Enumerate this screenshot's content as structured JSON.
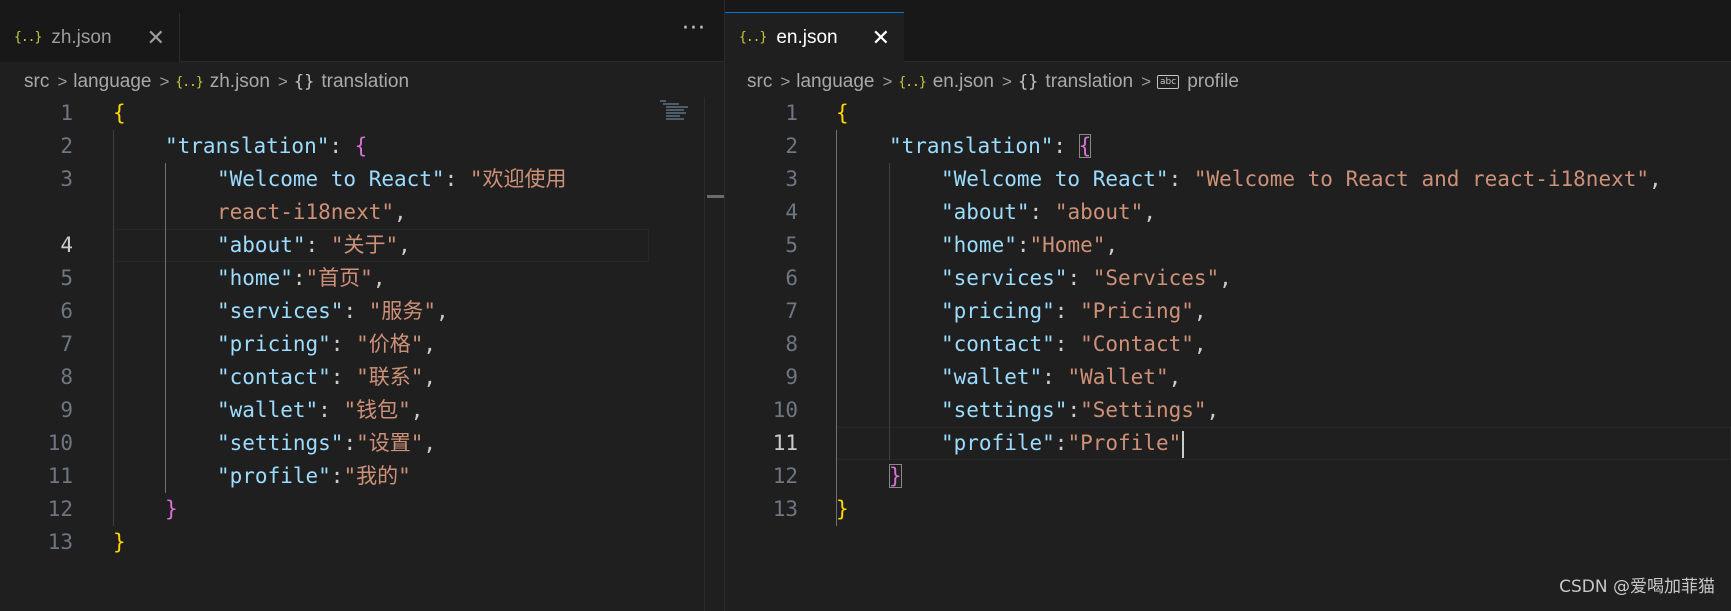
{
  "left": {
    "tab": {
      "icon": "{..}",
      "label": "zh.json",
      "close": "✕"
    },
    "more": "···",
    "breadcrumb": {
      "part1": "src",
      "part2": "language",
      "file_icon": "{..}",
      "file": "zh.json",
      "obj_icon": "{}",
      "key": "translation"
    },
    "current_line": "4",
    "lines": [
      {
        "num": "1"
      },
      {
        "num": "2"
      },
      {
        "num": "3"
      },
      {
        "num": ""
      },
      {
        "num": "4"
      },
      {
        "num": "5"
      },
      {
        "num": "6"
      },
      {
        "num": "7"
      },
      {
        "num": "8"
      },
      {
        "num": "9"
      },
      {
        "num": "10"
      },
      {
        "num": "11"
      },
      {
        "num": "12"
      },
      {
        "num": "13"
      }
    ],
    "code": {
      "open_brace": "{",
      "translation_key": "\"translation\"",
      "colon_sp": ": ",
      "translation_open": "{",
      "entries": [
        {
          "key": "\"Welcome to React\"",
          "sep": ": ",
          "val": "\"欢迎使用",
          "tail": ""
        },
        {
          "key": "",
          "sep": "",
          "val": "react-i18next\"",
          "tail": ","
        },
        {
          "key": "\"about\"",
          "sep": ": ",
          "val": "\"关于\"",
          "tail": ","
        },
        {
          "key": "\"home\"",
          "sep": ":",
          "val": "\"首页\"",
          "tail": ","
        },
        {
          "key": "\"services\"",
          "sep": ": ",
          "val": "\"服务\"",
          "tail": ","
        },
        {
          "key": "\"pricing\"",
          "sep": ": ",
          "val": "\"价格\"",
          "tail": ","
        },
        {
          "key": "\"contact\"",
          "sep": ": ",
          "val": "\"联系\"",
          "tail": ","
        },
        {
          "key": "\"wallet\"",
          "sep": ": ",
          "val": "\"钱包\"",
          "tail": ","
        },
        {
          "key": "\"settings\"",
          "sep": ":",
          "val": "\"设置\"",
          "tail": ","
        },
        {
          "key": "\"profile\"",
          "sep": ":",
          "val": "\"我的\"",
          "tail": ""
        }
      ],
      "translation_close": "}",
      "close_brace": "}"
    }
  },
  "right": {
    "tab": {
      "icon": "{..}",
      "label": "en.json",
      "close": "✕"
    },
    "breadcrumb": {
      "part1": "src",
      "part2": "language",
      "file_icon": "{..}",
      "file": "en.json",
      "obj_icon": "{}",
      "key": "translation",
      "str_icon": "abc",
      "key2": "profile"
    },
    "current_line": "11",
    "lines": [
      {
        "num": "1"
      },
      {
        "num": "2"
      },
      {
        "num": "3"
      },
      {
        "num": "4"
      },
      {
        "num": "5"
      },
      {
        "num": "6"
      },
      {
        "num": "7"
      },
      {
        "num": "8"
      },
      {
        "num": "9"
      },
      {
        "num": "10"
      },
      {
        "num": "11"
      },
      {
        "num": "12"
      },
      {
        "num": "13"
      }
    ],
    "code": {
      "open_brace": "{",
      "translation_key": "\"translation\"",
      "colon_sp": ": ",
      "translation_open": "{",
      "entries": [
        {
          "key": "\"Welcome to React\"",
          "sep": ": ",
          "val": "\"Welcome to React and react-i18next\"",
          "tail": ","
        },
        {
          "key": "\"about\"",
          "sep": ": ",
          "val": "\"about\"",
          "tail": ","
        },
        {
          "key": "\"home\"",
          "sep": ":",
          "val": "\"Home\"",
          "tail": ","
        },
        {
          "key": "\"services\"",
          "sep": ": ",
          "val": "\"Services\"",
          "tail": ","
        },
        {
          "key": "\"pricing\"",
          "sep": ": ",
          "val": "\"Pricing\"",
          "tail": ","
        },
        {
          "key": "\"contact\"",
          "sep": ": ",
          "val": "\"Contact\"",
          "tail": ","
        },
        {
          "key": "\"wallet\"",
          "sep": ": ",
          "val": "\"Wallet\"",
          "tail": ","
        },
        {
          "key": "\"settings\"",
          "sep": ":",
          "val": "\"Settings\"",
          "tail": ","
        },
        {
          "key": "\"profile\"",
          "sep": ":",
          "val": "\"Profile\"",
          "tail": ""
        }
      ],
      "translation_close": "}",
      "close_brace": "}"
    }
  },
  "watermark": "CSDN @爱喝加菲猫",
  "colors": {
    "key": "#9cdcfe",
    "string": "#ce9178",
    "bracket1": "#ffd700",
    "bracket2": "#da70d6",
    "accent": "#0078d4"
  }
}
